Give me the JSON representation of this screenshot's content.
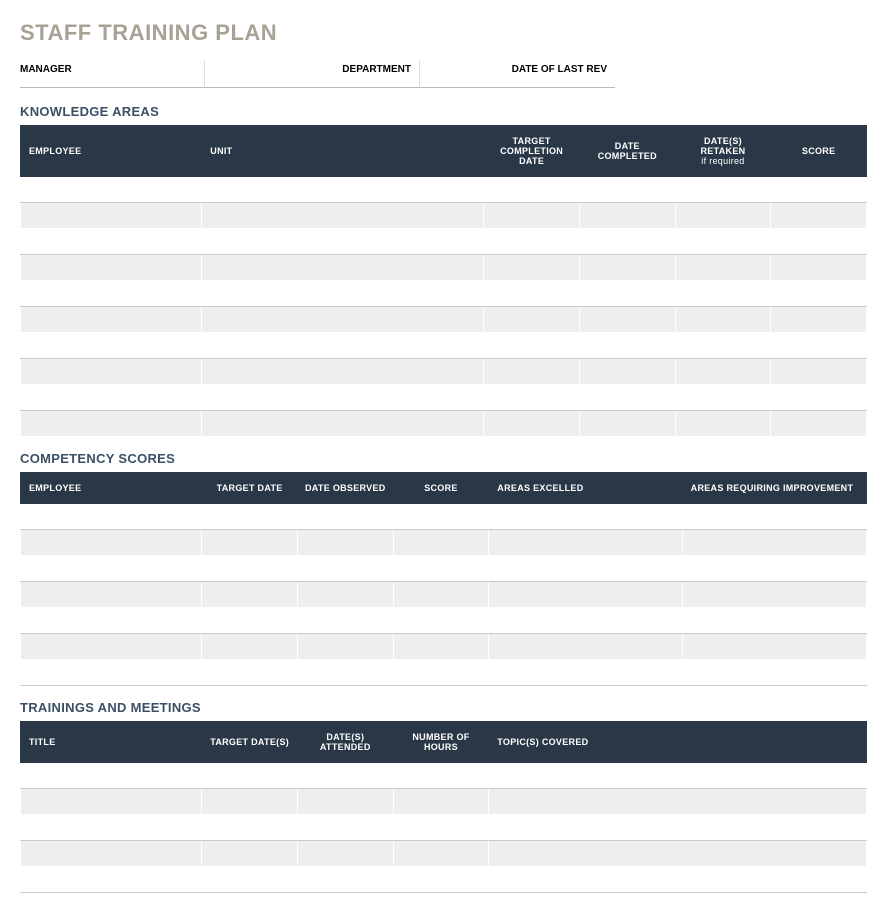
{
  "title": "STAFF TRAINING PLAN",
  "meta": {
    "manager_label": "MANAGER",
    "department_label": "DEPARTMENT",
    "date_rev_label": "DATE OF LAST REV",
    "manager_value": "",
    "department_value": "",
    "date_rev_value": ""
  },
  "sections": {
    "knowledge": {
      "title": "KNOWLEDGE AREAS",
      "headers": {
        "employee": "EMPLOYEE",
        "unit": "UNIT",
        "target_completion": "TARGET COMPLETION DATE",
        "date_completed": "DATE COMPLETED",
        "dates_retaken": "DATE(S) RETAKEN",
        "dates_retaken_sub": "if required",
        "score": "SCORE"
      },
      "rows": [
        {
          "employee": "",
          "unit": "",
          "target_completion": "",
          "date_completed": "",
          "dates_retaken": "",
          "score": ""
        },
        {
          "employee": "",
          "unit": "",
          "target_completion": "",
          "date_completed": "",
          "dates_retaken": "",
          "score": ""
        },
        {
          "employee": "",
          "unit": "",
          "target_completion": "",
          "date_completed": "",
          "dates_retaken": "",
          "score": ""
        },
        {
          "employee": "",
          "unit": "",
          "target_completion": "",
          "date_completed": "",
          "dates_retaken": "",
          "score": ""
        },
        {
          "employee": "",
          "unit": "",
          "target_completion": "",
          "date_completed": "",
          "dates_retaken": "",
          "score": ""
        },
        {
          "employee": "",
          "unit": "",
          "target_completion": "",
          "date_completed": "",
          "dates_retaken": "",
          "score": ""
        },
        {
          "employee": "",
          "unit": "",
          "target_completion": "",
          "date_completed": "",
          "dates_retaken": "",
          "score": ""
        },
        {
          "employee": "",
          "unit": "",
          "target_completion": "",
          "date_completed": "",
          "dates_retaken": "",
          "score": ""
        },
        {
          "employee": "",
          "unit": "",
          "target_completion": "",
          "date_completed": "",
          "dates_retaken": "",
          "score": ""
        },
        {
          "employee": "",
          "unit": "",
          "target_completion": "",
          "date_completed": "",
          "dates_retaken": "",
          "score": ""
        }
      ]
    },
    "competency": {
      "title": "COMPETENCY SCORES",
      "headers": {
        "employee": "EMPLOYEE",
        "target_date": "TARGET DATE",
        "date_observed": "DATE OBSERVED",
        "score": "SCORE",
        "areas_excelled": "AREAS EXCELLED",
        "areas_improvement": "AREAS REQUIRING IMPROVEMENT"
      },
      "rows": [
        {
          "employee": "",
          "target_date": "",
          "date_observed": "",
          "score": "",
          "areas_excelled": "",
          "areas_improvement": ""
        },
        {
          "employee": "",
          "target_date": "",
          "date_observed": "",
          "score": "",
          "areas_excelled": "",
          "areas_improvement": ""
        },
        {
          "employee": "",
          "target_date": "",
          "date_observed": "",
          "score": "",
          "areas_excelled": "",
          "areas_improvement": ""
        },
        {
          "employee": "",
          "target_date": "",
          "date_observed": "",
          "score": "",
          "areas_excelled": "",
          "areas_improvement": ""
        },
        {
          "employee": "",
          "target_date": "",
          "date_observed": "",
          "score": "",
          "areas_excelled": "",
          "areas_improvement": ""
        },
        {
          "employee": "",
          "target_date": "",
          "date_observed": "",
          "score": "",
          "areas_excelled": "",
          "areas_improvement": ""
        },
        {
          "employee": "",
          "target_date": "",
          "date_observed": "",
          "score": "",
          "areas_excelled": "",
          "areas_improvement": ""
        }
      ]
    },
    "trainings": {
      "title": "TRAININGS AND MEETINGS",
      "headers": {
        "title": "TITLE",
        "target_dates": "TARGET DATE(S)",
        "dates_attended": "DATE(S) ATTENDED",
        "hours": "NUMBER OF HOURS",
        "topics": "TOPIC(S) COVERED"
      },
      "rows": [
        {
          "title": "",
          "target_dates": "",
          "dates_attended": "",
          "hours": "",
          "topics": ""
        },
        {
          "title": "",
          "target_dates": "",
          "dates_attended": "",
          "hours": "",
          "topics": ""
        },
        {
          "title": "",
          "target_dates": "",
          "dates_attended": "",
          "hours": "",
          "topics": ""
        },
        {
          "title": "",
          "target_dates": "",
          "dates_attended": "",
          "hours": "",
          "topics": ""
        },
        {
          "title": "",
          "target_dates": "",
          "dates_attended": "",
          "hours": "",
          "topics": ""
        }
      ]
    }
  }
}
